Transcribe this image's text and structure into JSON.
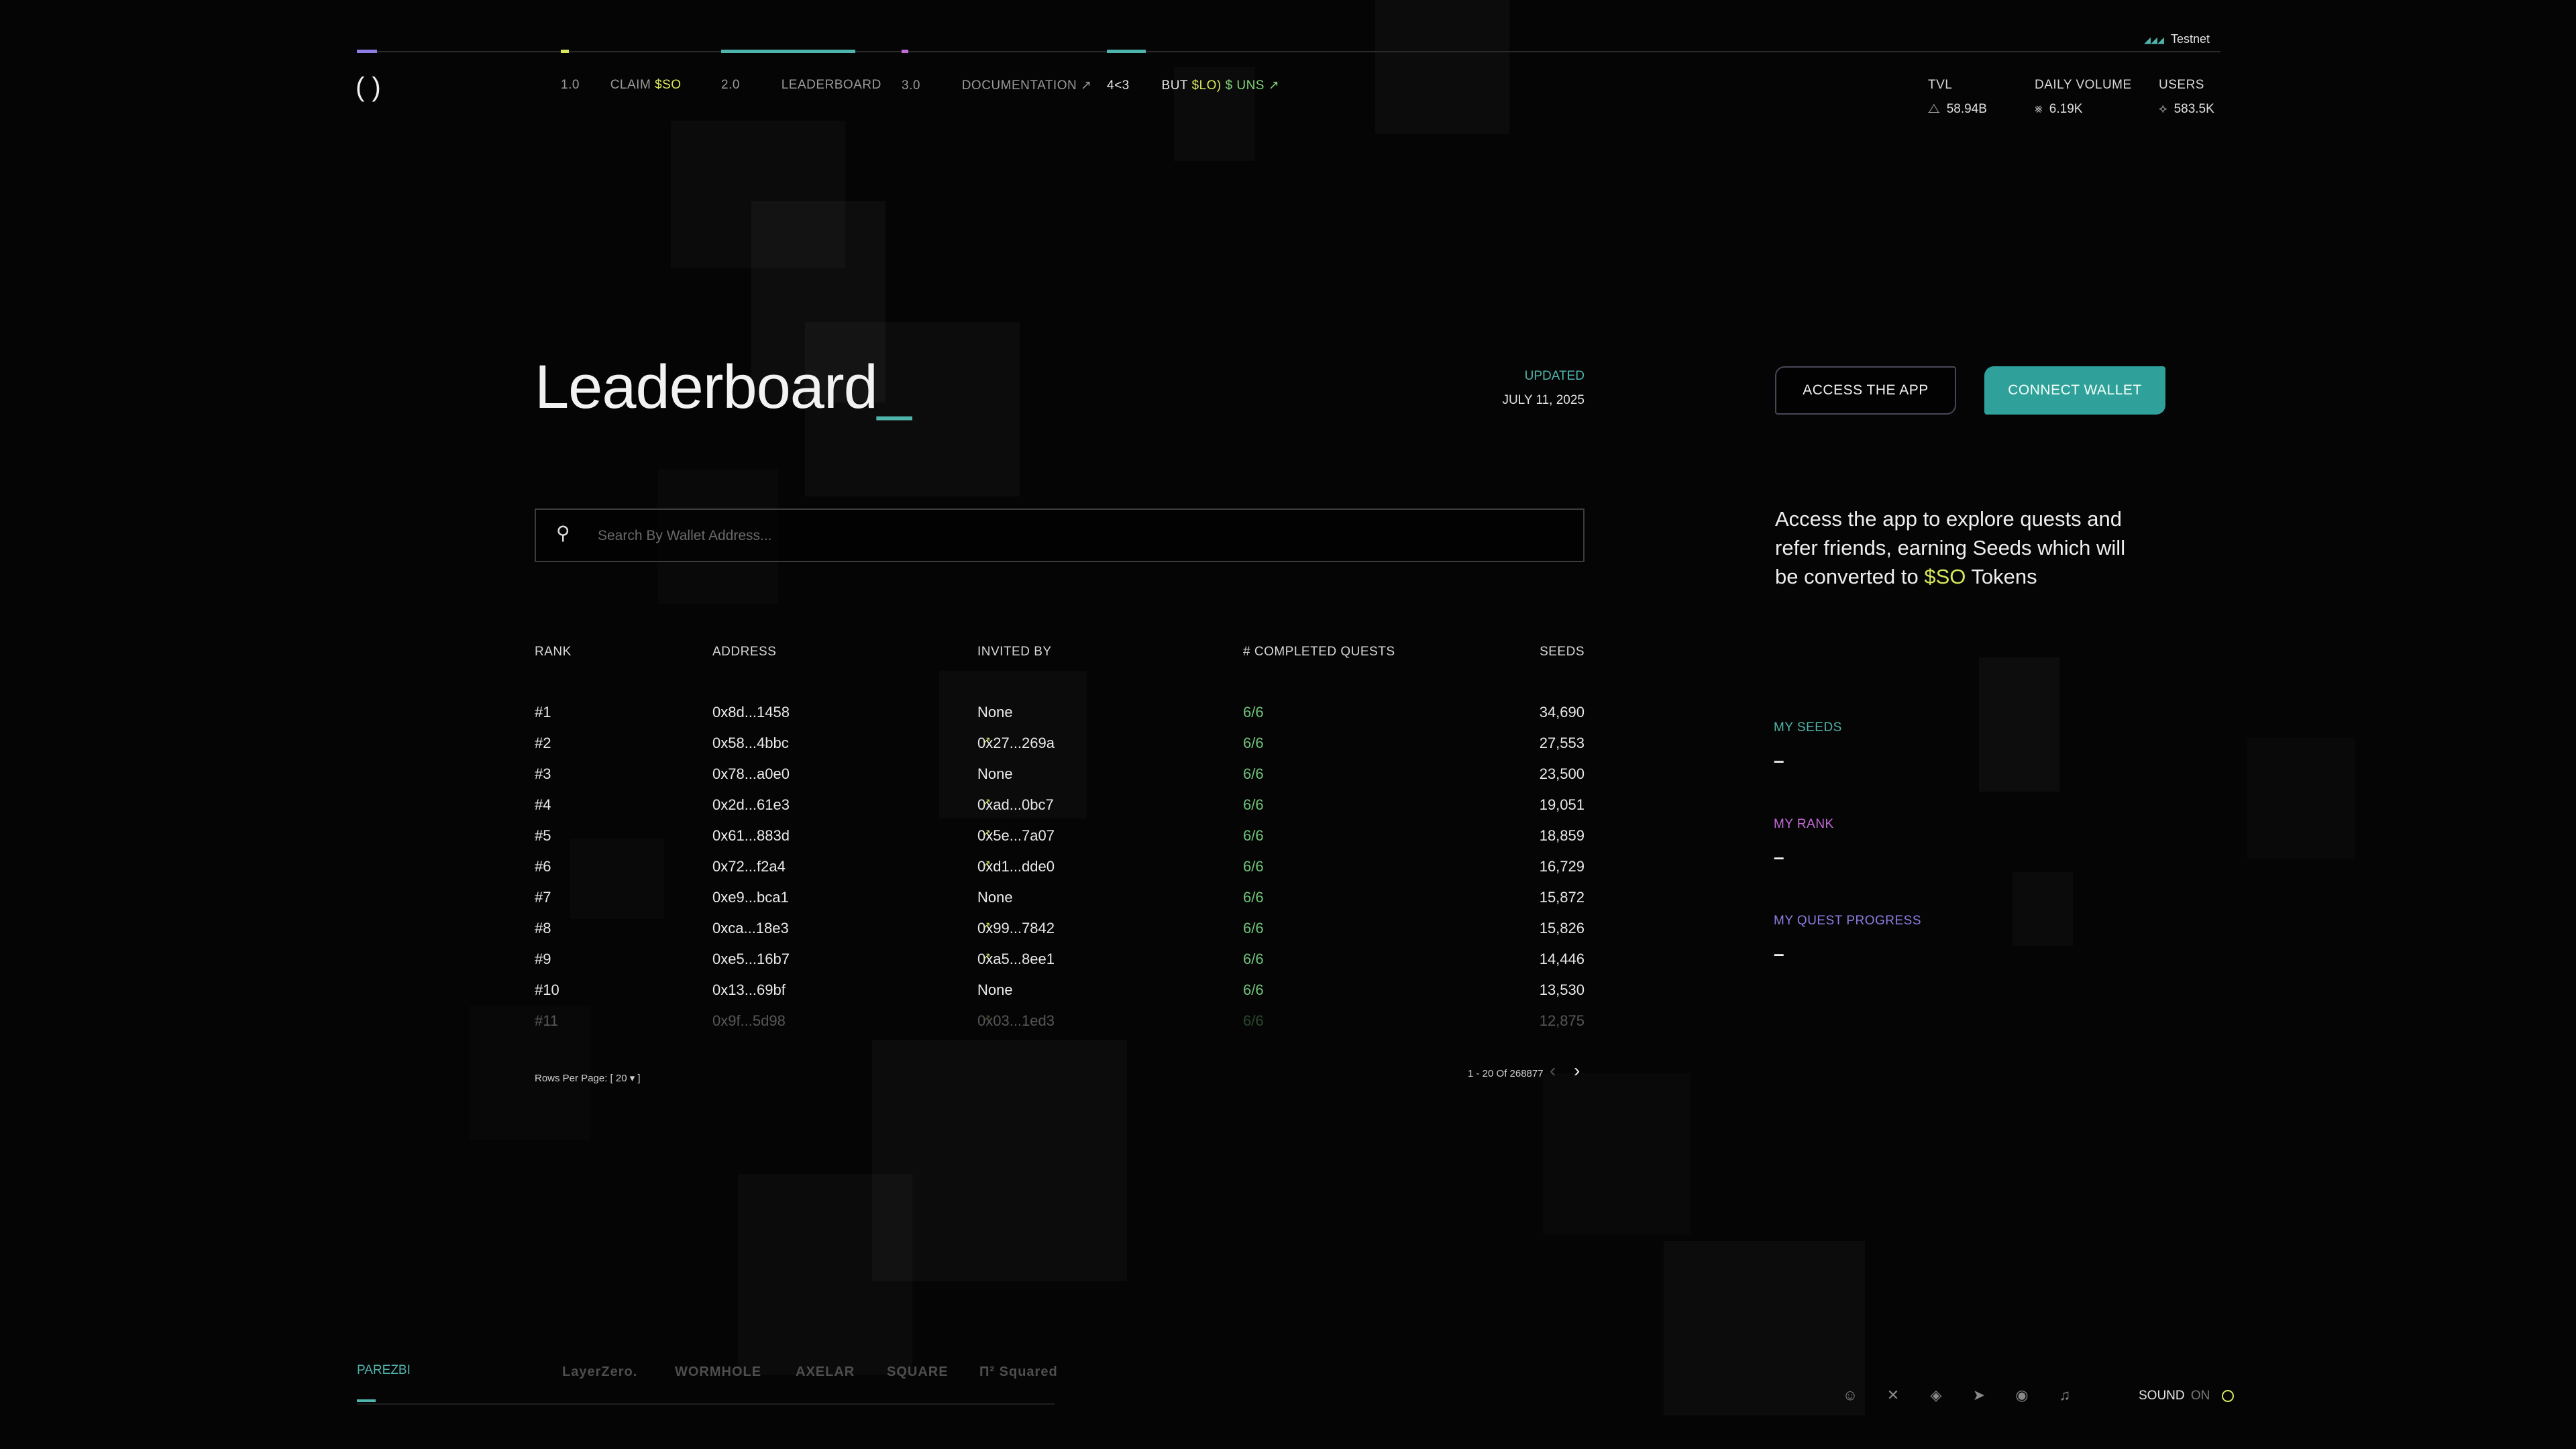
{
  "network": "Testnet",
  "nav": {
    "items": [
      {
        "num": "1.0",
        "label": "CLAIM",
        "token": "$SO"
      },
      {
        "num": "2.0",
        "label": "LEADERBOARD"
      },
      {
        "num": "3.0",
        "label": "DOCUMENTATION",
        "ext": "↗"
      },
      {
        "num": "4<3",
        "label": "BUT",
        "token": "$LO)",
        "extra": "$ UNS",
        "ext": "↗"
      }
    ]
  },
  "stats": [
    {
      "label": "TVL",
      "value": "58.94B",
      "icon": "tvl-icon"
    },
    {
      "label": "DAILY VOLUME",
      "value": "6.19K",
      "icon": "volume-icon"
    },
    {
      "label": "USERS",
      "value": "583.5K",
      "icon": "users-icon"
    }
  ],
  "page": {
    "title": "Leaderboard",
    "cursor": "_",
    "updated_label": "UPDATED",
    "updated_date": "JULY 11, 2025"
  },
  "search": {
    "placeholder": "Search By Wallet Address..."
  },
  "table": {
    "headers": {
      "rank": "RANK",
      "address": "ADDRESS",
      "invited_by": "INVITED BY",
      "quests": "# COMPLETED QUESTS",
      "seeds": "SEEDS"
    },
    "rows": [
      {
        "rank": "#1",
        "address": "0x8d...1458",
        "invited_by": "None",
        "quests": "6/6",
        "seeds": "34,690"
      },
      {
        "rank": "#2",
        "address": "0x58...4bbc",
        "invited_by": "0x27...269a",
        "quests": "6/6",
        "seeds": "27,553"
      },
      {
        "rank": "#3",
        "address": "0x78...a0e0",
        "invited_by": "None",
        "quests": "6/6",
        "seeds": "23,500"
      },
      {
        "rank": "#4",
        "address": "0x2d...61e3",
        "invited_by": "0xad...0bc7",
        "quests": "6/6",
        "seeds": "19,051"
      },
      {
        "rank": "#5",
        "address": "0x61...883d",
        "invited_by": "0x5e...7a07",
        "quests": "6/6",
        "seeds": "18,859"
      },
      {
        "rank": "#6",
        "address": "0x72...f2a4",
        "invited_by": "0xd1...dde0",
        "quests": "6/6",
        "seeds": "16,729"
      },
      {
        "rank": "#7",
        "address": "0xe9...bca1",
        "invited_by": "None",
        "quests": "6/6",
        "seeds": "15,872"
      },
      {
        "rank": "#8",
        "address": "0xca...18e3",
        "invited_by": "0x99...7842",
        "quests": "6/6",
        "seeds": "15,826"
      },
      {
        "rank": "#9",
        "address": "0xe5...16b7",
        "invited_by": "0xa5...8ee1",
        "quests": "6/6",
        "seeds": "14,446"
      },
      {
        "rank": "#10",
        "address": "0x13...69bf",
        "invited_by": "None",
        "quests": "6/6",
        "seeds": "13,530"
      },
      {
        "rank": "#11",
        "address": "0x9f...5d98",
        "invited_by": "0x03...1ed3",
        "quests": "6/6",
        "seeds": "12,875"
      }
    ],
    "rows_per_page_label": "Rows Per Page: [ 20 ▾ ]",
    "pagination": "1 - 20 Of 268877"
  },
  "actions": {
    "access": "ACCESS THE APP",
    "connect": "CONNECT WALLET"
  },
  "promo": {
    "before": "Access the app to explore quests and refer friends, earning Seeds which will be converted to ",
    "token": "$SO",
    "after": " Tokens"
  },
  "my_stats": [
    {
      "label": "MY SEEDS",
      "value": "–"
    },
    {
      "label": "MY RANK",
      "value": "–"
    },
    {
      "label": "MY QUEST PROGRESS",
      "value": "–"
    }
  ],
  "footer": {
    "section": "PAREZBI",
    "partners": [
      "LayerZero.",
      "WORMHOLE",
      "AXELAR",
      "SQUARE",
      "Π² Squared"
    ],
    "sound_label": "SOUND",
    "sound_state": "ON",
    "socials": [
      "discord-icon",
      "x-icon",
      "docs-icon",
      "telegram-icon",
      "github-icon",
      "bell-icon"
    ]
  },
  "colors": {
    "accent_teal": "#2fa19a",
    "quest_green": "#6fc47a",
    "token_yellow": "#d9e85a",
    "rank_purple": "#c46bd8",
    "progress_violet": "#8e7ee3"
  }
}
